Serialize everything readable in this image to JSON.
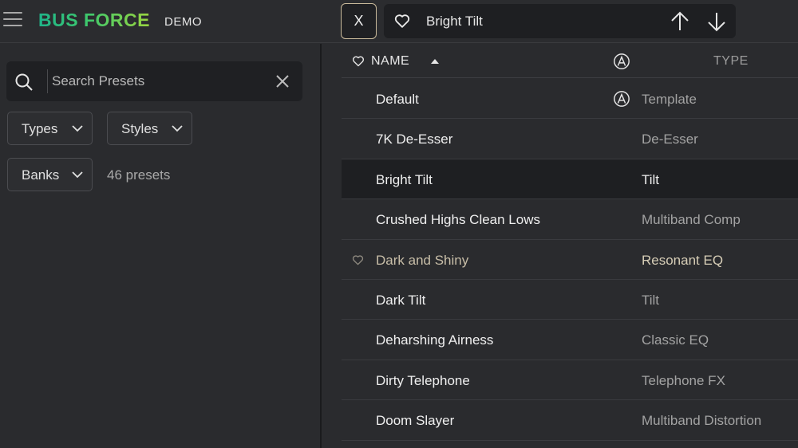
{
  "header": {
    "logo": "BUS FORCE",
    "mode": "DEMO",
    "close_label": "X",
    "current_preset": "Bright Tilt"
  },
  "search": {
    "placeholder": "Search Presets"
  },
  "filters": {
    "types": "Types",
    "styles": "Styles",
    "banks": "Banks",
    "count": "46 presets"
  },
  "table": {
    "col_name": "NAME",
    "col_type": "TYPE",
    "rows": [
      {
        "name": "Default",
        "type": "Template",
        "factory_icon": true
      },
      {
        "name": "7K De-Esser",
        "type": "De-Esser"
      },
      {
        "name": "Bright Tilt",
        "type": "Tilt",
        "selected": true
      },
      {
        "name": "Crushed Highs Clean Lows",
        "type": "Multiband Comp"
      },
      {
        "name": "Dark and Shiny",
        "type": "Resonant EQ",
        "heart_visible": true
      },
      {
        "name": "Dark Tilt",
        "type": "Tilt"
      },
      {
        "name": "Deharshing Airness",
        "type": "Classic EQ"
      },
      {
        "name": "Dirty Telephone",
        "type": "Telephone FX"
      },
      {
        "name": "Doom Slayer",
        "type": "Multiband Distortion"
      }
    ]
  },
  "colors": {
    "logo_gradient_start": "#1fb58a",
    "logo_gradient_end": "#9ad640",
    "close_border": "#c8b99a",
    "selected_row": "#1e1f22",
    "favorite_text": "#c8bea8"
  },
  "icons": [
    "menu-icon",
    "heart-icon",
    "arrow-up-icon",
    "arrow-down-icon",
    "search-icon",
    "clear-icon",
    "chevron-down-icon",
    "factory-icon"
  ]
}
